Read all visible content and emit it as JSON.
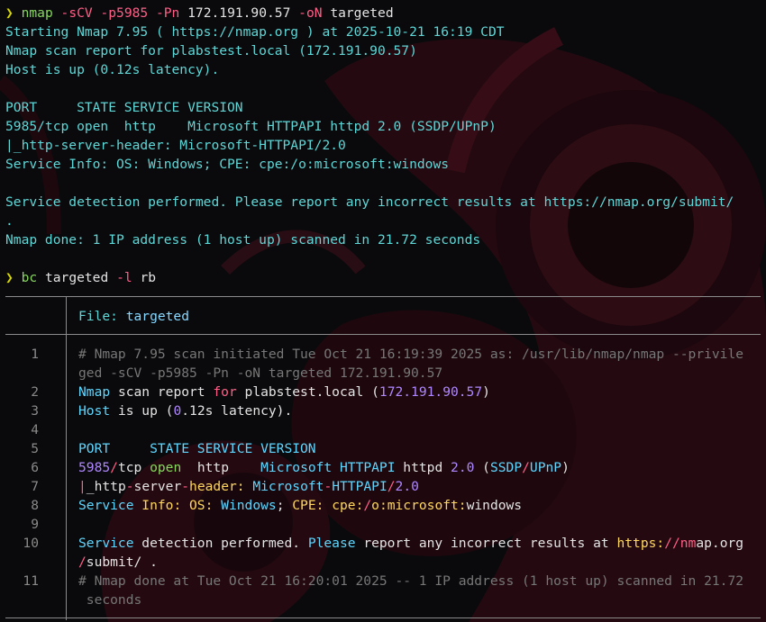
{
  "colors": {
    "background": "#0a0a0c",
    "output_cyan": "#5fd7d7",
    "prompt_yellow": "#d7d700",
    "command_green": "#87d75f",
    "flag_pink": "#ff5f87",
    "comment_gray": "#777777",
    "number_purple": "#af87ff",
    "keyword_blue": "#5fd7ff",
    "key_yellow": "#ffd75f",
    "backdrop_crimson": "#3a0a14"
  },
  "terminal": {
    "prompt_icon": "❯",
    "cmd1": {
      "program": "nmap",
      "flags": "-sCV -p5985 -Pn",
      "target": "172.191.90.57",
      "out_flag": "-oN",
      "out_file": "targeted"
    },
    "output_lines": [
      "Starting Nmap 7.95 ( https://nmap.org ) at 2025-10-21 16:19 CDT",
      "Nmap scan report for plabstest.local (172.191.90.57)",
      "Host is up (0.12s latency).",
      "",
      "PORT     STATE SERVICE VERSION",
      "5985/tcp open  http    Microsoft HTTPAPI httpd 2.0 (SSDP/UPnP)",
      "|_http-server-header: Microsoft-HTTPAPI/2.0",
      "Service Info: OS: Windows; CPE: cpe:/o:microsoft:windows",
      "",
      "Service detection performed. Please report any incorrect results at https://nmap.org/submit/",
      ".",
      "Nmap done: 1 IP address (1 host up) scanned in 21.72 seconds"
    ],
    "cmd2": {
      "program": "bc",
      "file": "targeted",
      "flag": "-l",
      "lang": "rb"
    }
  },
  "viewer": {
    "header_label": "File: ",
    "file_name": "targeted",
    "line_numbers": [
      "1",
      "",
      "2",
      "3",
      "4",
      "5",
      "6",
      "7",
      "8",
      "9",
      "10",
      "",
      "11",
      ""
    ],
    "lines": [
      {
        "segments": [
          {
            "text": "# Nmap 7.95 scan initiated Tue Oct 21 16:19:39 2025 as: /usr/lib/nmap/nmap --privile",
            "style": "cm"
          }
        ]
      },
      {
        "segments": [
          {
            "text": "ged -sCV -p5985 -Pn -oN targeted 172.191.90.57",
            "style": "cm"
          }
        ]
      },
      {
        "segments": [
          {
            "text": "Nmap",
            "style": "kw"
          },
          {
            "text": " scan ",
            "style": ""
          },
          {
            "text": "report",
            "style": ""
          },
          {
            "text": " for ",
            "style": "pk"
          },
          {
            "text": "plabstest.local (",
            "style": ""
          },
          {
            "text": "172.191.90.57",
            "style": "nu"
          },
          {
            "text": ")",
            "style": ""
          }
        ]
      },
      {
        "segments": [
          {
            "text": "Host",
            "style": "kw"
          },
          {
            "text": " is up (",
            "style": ""
          },
          {
            "text": "0",
            "style": "nu"
          },
          {
            "text": ".12s latency).",
            "style": ""
          }
        ]
      },
      {
        "segments": [
          {
            "text": "",
            "style": ""
          }
        ]
      },
      {
        "segments": [
          {
            "text": "PORT     STATE SERVICE VERSION",
            "style": "kw"
          }
        ]
      },
      {
        "segments": [
          {
            "text": "5985",
            "style": "nu"
          },
          {
            "text": "/",
            "style": "pk"
          },
          {
            "text": "tcp ",
            "style": ""
          },
          {
            "text": "open",
            "style": "gn"
          },
          {
            "text": "  http    ",
            "style": ""
          },
          {
            "text": "Microsoft HTTPAPI",
            "style": "kw"
          },
          {
            "text": " httpd ",
            "style": ""
          },
          {
            "text": "2.0",
            "style": "nu"
          },
          {
            "text": " (",
            "style": ""
          },
          {
            "text": "SSDP",
            "style": "kw"
          },
          {
            "text": "/",
            "style": "pk"
          },
          {
            "text": "UPnP",
            "style": "kw"
          },
          {
            "text": ")",
            "style": ""
          }
        ]
      },
      {
        "segments": [
          {
            "text": "|",
            "style": "pk"
          },
          {
            "text": "_http",
            "style": ""
          },
          {
            "text": "-",
            "style": "pk"
          },
          {
            "text": "server",
            "style": ""
          },
          {
            "text": "-",
            "style": "pk"
          },
          {
            "text": "header:",
            "style": "yl"
          },
          {
            "text": " Microsoft",
            "style": "kw"
          },
          {
            "text": "-",
            "style": "pk"
          },
          {
            "text": "HTTPAPI",
            "style": "kw"
          },
          {
            "text": "/",
            "style": "pk"
          },
          {
            "text": "2.0",
            "style": "nu"
          }
        ]
      },
      {
        "segments": [
          {
            "text": "Service",
            "style": "kw"
          },
          {
            "text": " Info: OS:",
            "style": "yl"
          },
          {
            "text": " Windows",
            "style": "kw"
          },
          {
            "text": "; ",
            "style": ""
          },
          {
            "text": "CPE:",
            "style": "yl"
          },
          {
            "text": " cpe:",
            "style": "yl"
          },
          {
            "text": "/",
            "style": "pk"
          },
          {
            "text": "o:microsoft:",
            "style": "yl"
          },
          {
            "text": "windows",
            "style": ""
          }
        ]
      },
      {
        "segments": [
          {
            "text": "",
            "style": ""
          }
        ]
      },
      {
        "segments": [
          {
            "text": "Service",
            "style": "kw"
          },
          {
            "text": " detection performed. ",
            "style": ""
          },
          {
            "text": "Please",
            "style": "kw"
          },
          {
            "text": " report any incorrect results at ",
            "style": ""
          },
          {
            "text": "https:",
            "style": "yl"
          },
          {
            "text": "//",
            "style": "pk"
          },
          {
            "text": "nm",
            "style": "pk"
          },
          {
            "text": "ap.org",
            "style": ""
          }
        ]
      },
      {
        "segments": [
          {
            "text": "/",
            "style": "pk"
          },
          {
            "text": "submit/ .",
            "style": ""
          }
        ]
      },
      {
        "segments": [
          {
            "text": "# Nmap done at Tue Oct 21 16:20:01 2025 -- 1 IP address (1 host up) scanned in 21.72",
            "style": "cm"
          }
        ]
      },
      {
        "segments": [
          {
            "text": " seconds",
            "style": "cm"
          }
        ]
      }
    ]
  }
}
